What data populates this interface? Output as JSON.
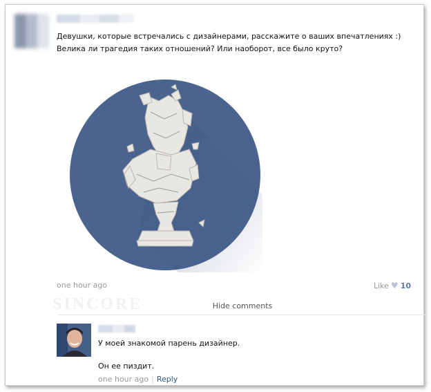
{
  "post": {
    "text": "Девушки, которые встречались с дизайнерами, расскажите о ваших впечатлениях :) Велика ли трагедия таких отношений? Или наоборот, все было круто?",
    "time": "one hour ago",
    "like_label": "Like",
    "like_count": "10"
  },
  "comments": {
    "hide_label": "Hide comments",
    "items": [
      {
        "line1": "У моей знакомой парень дизайнер.",
        "line2": "Он ее пиздит.",
        "time": "one hour ago",
        "reply_label": "Reply"
      }
    ]
  },
  "colors": {
    "circle": "#4a648f",
    "link": "#2b587a",
    "meta": "#999999"
  },
  "watermark": "SINCORE"
}
